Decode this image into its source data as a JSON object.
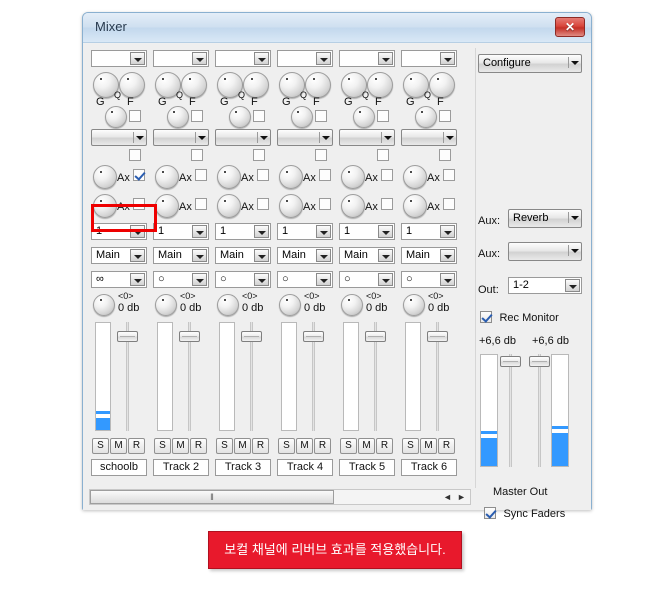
{
  "window": {
    "title": "Mixer",
    "close_label": "✕"
  },
  "toolbar": {
    "configure_label": "Configure",
    "channel_selects": [
      "",
      "",
      "",
      "",
      "",
      ""
    ]
  },
  "eq": {
    "gain_label": "G",
    "q_label": "Q",
    "freq_label": "F",
    "plugin_selects": [
      "",
      "",
      "",
      "",
      "",
      ""
    ]
  },
  "aux": {
    "label": "Ax",
    "send1_checked": [
      true,
      false,
      false,
      false,
      false,
      false
    ],
    "send2_checked": [
      false,
      false,
      false,
      false,
      false,
      false
    ]
  },
  "routing": {
    "input_values": [
      "1",
      "1",
      "1",
      "1",
      "1",
      "1"
    ],
    "output_values": [
      "Main",
      "Main",
      "Main",
      "Main",
      "Main",
      "Main"
    ],
    "pan_values": [
      "∞",
      "○",
      "○",
      "○",
      "○",
      "○"
    ]
  },
  "faders": {
    "pan_readout": "<0>",
    "gain_readout": "0 db",
    "channels": [
      {
        "pan": "<0>",
        "gain": "0 db"
      },
      {
        "pan": "<0>",
        "gain": "0 db"
      },
      {
        "pan": "<0>",
        "gain": "0 db"
      },
      {
        "pan": "<0>",
        "gain": "0 db"
      },
      {
        "pan": "<0>",
        "gain": "0 db"
      },
      {
        "pan": "<0>",
        "gain": "0 db"
      }
    ]
  },
  "buttons": {
    "solo": "S",
    "mute": "M",
    "rec": "R"
  },
  "tracks": [
    {
      "name": "schoolb"
    },
    {
      "name": "Track 2"
    },
    {
      "name": "Track 3"
    },
    {
      "name": "Track 4"
    },
    {
      "name": "Track 5"
    },
    {
      "name": "Track 6"
    }
  ],
  "master": {
    "aux1_label": "Aux:",
    "aux1_value": "Reverb",
    "aux2_label": "Aux:",
    "aux2_value": "",
    "out_label": "Out:",
    "out_value": "1-2",
    "rec_monitor_label": "Rec Monitor",
    "rec_monitor_checked": true,
    "db_left": "+6,6 db",
    "db_right": "+6,6 db",
    "master_out_label": "Master Out",
    "sync_faders_label": "Sync Faders",
    "sync_faders_checked": true
  },
  "scrollbar": {
    "grip": "‖",
    "left_arrow": "◄",
    "right_arrow": "►"
  },
  "banner": {
    "message": "보컬 채널에 리버브 효과를 적용했습니다."
  },
  "colors": {
    "accent": "#3399ff",
    "highlight": "#ee0000",
    "banner_bg": "#e8192c",
    "title_bg": "#cfe0f0"
  }
}
